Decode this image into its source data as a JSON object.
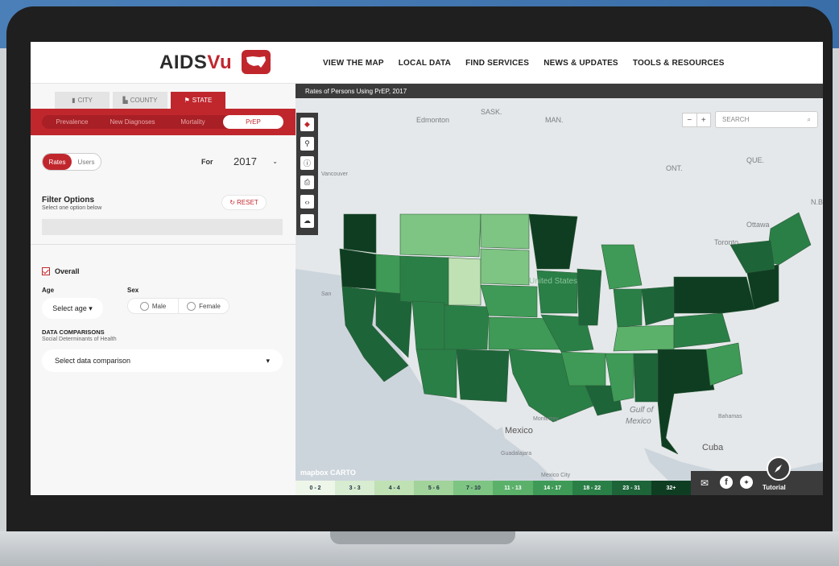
{
  "brand": {
    "name_a": "AIDS",
    "name_b": "Vu"
  },
  "nav": [
    "VIEW THE MAP",
    "LOCAL DATA",
    "FIND SERVICES",
    "NEWS & UPDATES",
    "TOOLS & RESOURCES"
  ],
  "geo_tabs": [
    {
      "label": "CITY",
      "active": false
    },
    {
      "label": "COUNTY",
      "active": false
    },
    {
      "label": "STATE",
      "active": true
    }
  ],
  "measure_tabs": [
    {
      "label": "Prevalence",
      "active": false
    },
    {
      "label": "New Diagnoses",
      "active": false
    },
    {
      "label": "Mortality",
      "active": false
    },
    {
      "label": "PrEP",
      "active": true
    }
  ],
  "toggle": {
    "rates": "Rates",
    "users": "Users",
    "active": "Rates"
  },
  "year": {
    "label": "For",
    "value": "2017"
  },
  "filters": {
    "title": "Filter Options",
    "subtitle": "Select one option below",
    "reset": "RESET"
  },
  "demographics": {
    "overall": "Overall",
    "overall_checked": true,
    "age_label": "Age",
    "age_placeholder": "Select age",
    "sex_label": "Sex",
    "male": "Male",
    "female": "Female"
  },
  "comparisons": {
    "title": "DATA COMPARISONS",
    "subtitle": "Social Determinants of Health",
    "placeholder": "Select data comparison"
  },
  "map": {
    "title": "Rates of Persons Using PrEP, 2017",
    "search_placeholder": "SEARCH",
    "zoom_out": "−",
    "zoom_in": "+",
    "attribution": "mapbox  CARTO",
    "labels": [
      "Edmonton",
      "SASK.",
      "MAN.",
      "ONT.",
      "QUE.",
      "N.B.",
      "Ottawa",
      "Toronto",
      "United States",
      "Gulf of",
      "Mexico",
      "Monterrey",
      "Mexico",
      "Guadalajara",
      "Mexico City",
      "Cuba",
      "Bahamas",
      "Vancouver",
      "San"
    ],
    "tutorial": "Tutorial",
    "tools": [
      "layers-icon",
      "location-pin-icon",
      "info-icon",
      "print-icon",
      "embed-icon",
      "download-icon"
    ]
  },
  "legend": [
    {
      "label": "0 - 2",
      "color": "#eef6e9"
    },
    {
      "label": "3 - 3",
      "color": "#d7ecd0"
    },
    {
      "label": "4 - 4",
      "color": "#bfe1b4"
    },
    {
      "label": "5 - 6",
      "color": "#a1d39a"
    },
    {
      "label": "7 - 10",
      "color": "#7ec483"
    },
    {
      "label": "11 - 13",
      "color": "#5bb16a"
    },
    {
      "label": "14 - 17",
      "color": "#3e9a56"
    },
    {
      "label": "18 - 22",
      "color": "#2a7f47"
    },
    {
      "label": "23 - 31",
      "color": "#1d6439"
    },
    {
      "label": "32+",
      "color": "#0f3d22"
    }
  ],
  "accent": "#c0272d"
}
